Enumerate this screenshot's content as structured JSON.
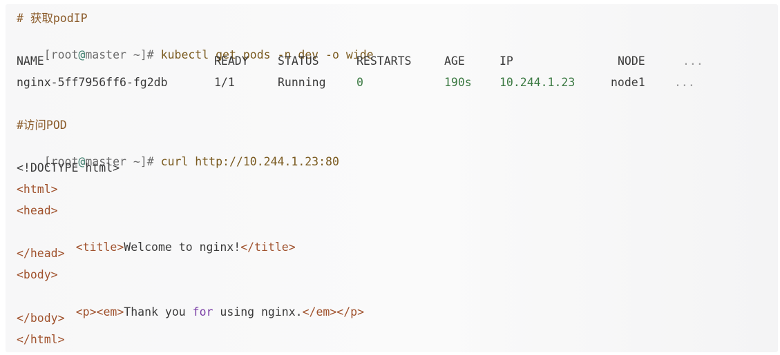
{
  "comment1": "# 获取podIP",
  "cmd1": {
    "prompt_user": "[root",
    "prompt_at": "@",
    "prompt_host": "master ~]#",
    "command": " kubectl get pods -n dev -o wide"
  },
  "table": {
    "headers": [
      "NAME",
      "READY",
      "STATUS",
      "RESTARTS",
      "AGE",
      "IP",
      "NODE",
      "..."
    ],
    "row": [
      "nginx-5ff7956ff6-fg2db",
      "1/1",
      "Running",
      "0",
      "190s",
      "10.244.1.23",
      "node1",
      "..."
    ]
  },
  "comment2": "#访问POD",
  "cmd2": {
    "prompt_user": "[root",
    "prompt_at": "@",
    "prompt_host": "master ~]#",
    "command": " curl http://10.244.1.23:80"
  },
  "output": {
    "doctype": "<!DOCTYPE html>",
    "html_open": "<html>",
    "head_open": "<head>",
    "title_open": "<title>",
    "title_text": "Welcome to nginx!",
    "title_close": "</title>",
    "head_close": "</head>",
    "body_open": "<body>",
    "p_open": "<p><em>",
    "p_text1": "Thank you ",
    "p_kw": "for",
    "p_text2": " using nginx.",
    "p_close": "</em></p>",
    "body_close": "</body>",
    "html_close": "</html>"
  }
}
